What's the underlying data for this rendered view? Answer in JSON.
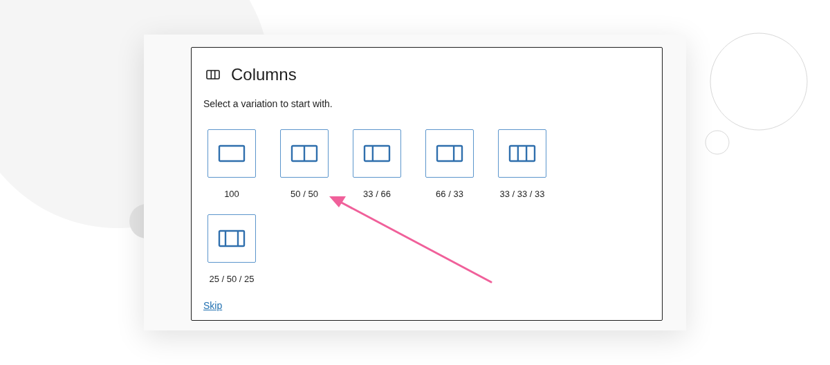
{
  "block": {
    "title": "Columns",
    "instructions": "Select a variation to start with."
  },
  "variations": [
    {
      "label": "100",
      "kind": "single"
    },
    {
      "label": "50 / 50",
      "kind": "halves"
    },
    {
      "label": "33 / 66",
      "kind": "narrow-wide"
    },
    {
      "label": "66 / 33",
      "kind": "wide-narrow"
    },
    {
      "label": "33 / 33 / 33",
      "kind": "thirds"
    },
    {
      "label": "25 / 50 / 25",
      "kind": "wide-center"
    }
  ],
  "skip_link": "Skip"
}
